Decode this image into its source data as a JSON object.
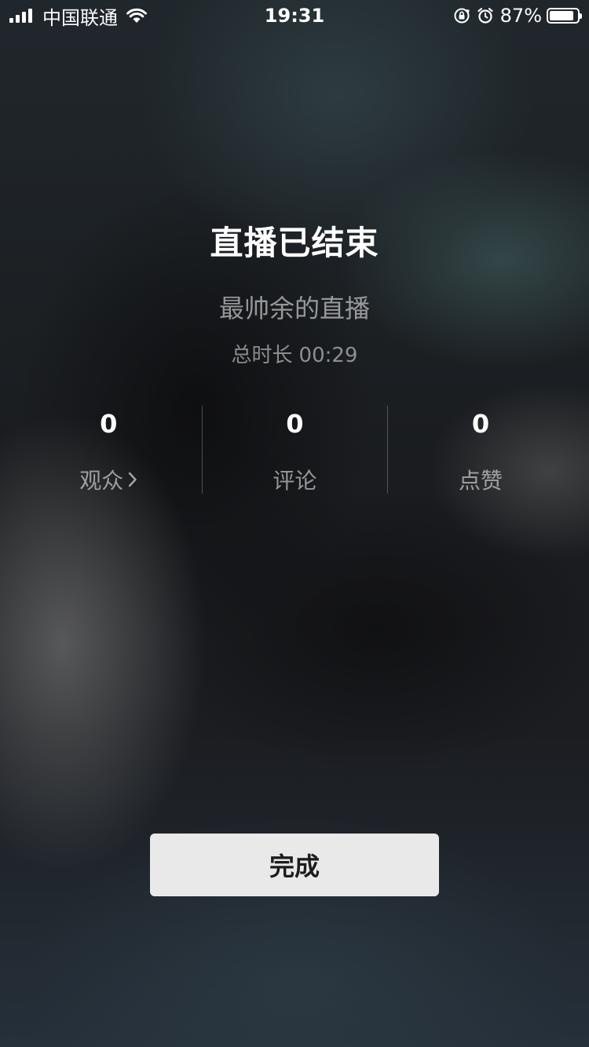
{
  "status_bar": {
    "carrier": "中国联通",
    "time": "19:31",
    "battery_percent": "87%",
    "battery_level": 0.87,
    "icons": [
      "signal-icon",
      "wifi-icon",
      "orientation-lock-icon",
      "alarm-icon",
      "battery-icon"
    ]
  },
  "main": {
    "title": "直播已结束",
    "stream_name": "最帅余的直播",
    "duration_label": "总时长",
    "duration_value": "00:29",
    "stats": [
      {
        "value": "0",
        "label": "观众"
      },
      {
        "value": "0",
        "label": "评论"
      },
      {
        "value": "0",
        "label": "点赞"
      }
    ],
    "done_label": "完成"
  },
  "colors": {
    "title_text": "#ffffff",
    "secondary_text": "#8e8e8e",
    "button_bg": "#e9e9ea",
    "button_text": "#1d1d1d"
  }
}
